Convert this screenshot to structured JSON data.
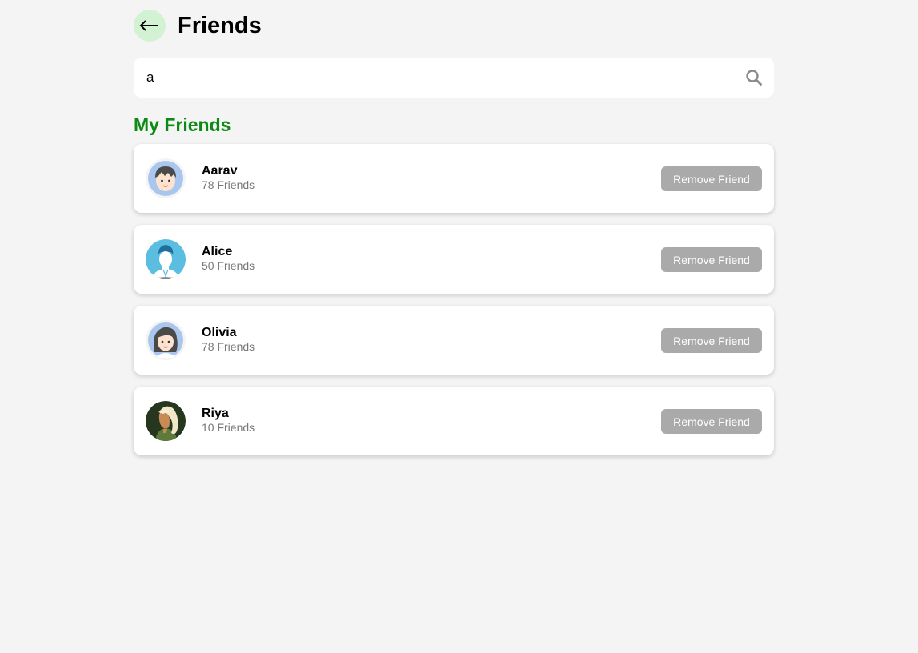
{
  "header": {
    "title": "Friends",
    "back_icon": "back-arrow-icon"
  },
  "search": {
    "value": "a",
    "placeholder": "",
    "icon": "search-icon"
  },
  "section": {
    "title": "My Friends"
  },
  "friends": [
    {
      "name": "Aarav",
      "count": "78 Friends",
      "button": "Remove Friend",
      "avatar": "boy-avatar"
    },
    {
      "name": "Alice",
      "count": "50 Friends",
      "button": "Remove Friend",
      "avatar": "silhouette-avatar"
    },
    {
      "name": "Olivia",
      "count": "78 Friends",
      "button": "Remove Friend",
      "avatar": "girl-avatar"
    },
    {
      "name": "Riya",
      "count": "10 Friends",
      "button": "Remove Friend",
      "avatar": "blonde-woman-avatar"
    }
  ],
  "colors": {
    "background": "#f4f4f4",
    "back_button_bg": "#d3f1d3",
    "section_title": "#0c8a14",
    "remove_button_bg": "#aaaaaa",
    "secondary_text": "#777777"
  }
}
